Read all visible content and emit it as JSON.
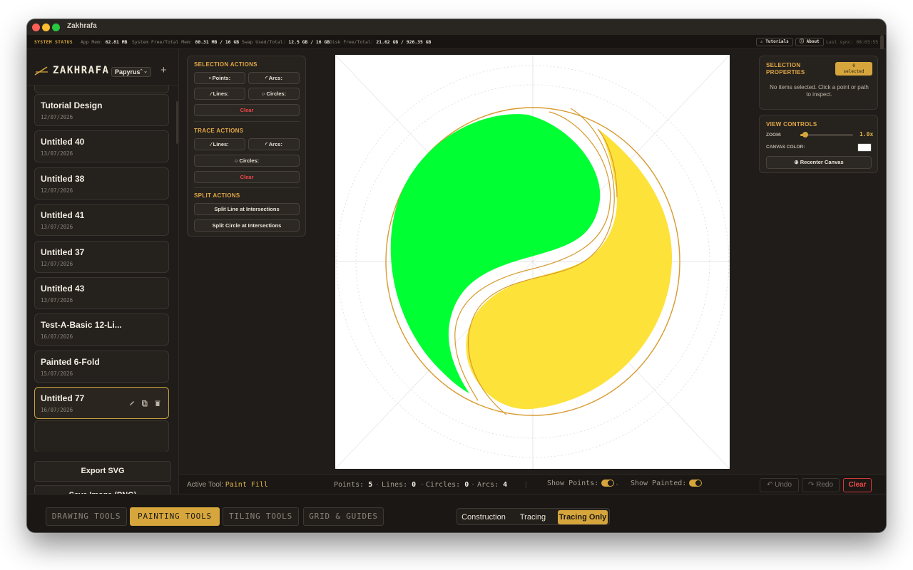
{
  "window": {
    "title": "Zakhrafa"
  },
  "system_status": {
    "label": "SYSTEM STATUS",
    "app_mem_label": "App Mem:",
    "app_mem": "62.81 MB",
    "sys_mem_label": "System Free/Total Mem:",
    "sys_mem": "80.31 MB / 16 GB",
    "swap_label": "Swap Used/Total:",
    "swap": "12.5 GB / 16 GB",
    "disk_label": "Disk Free/Total:",
    "disk": "21.62 GB / 926.35 GB",
    "tutorials_label": "Tutorials",
    "about_label": "About",
    "last_sync": "Last sync: 08:03:55"
  },
  "sidebar": {
    "app_name": "ZAKHRAFA",
    "font_selected": "Papyrus",
    "add_label": "+",
    "designs": [
      {
        "title": "Tutorial Design",
        "date": "12/07/2026"
      },
      {
        "title": "Untitled 40",
        "date": "13/07/2026"
      },
      {
        "title": "Untitled 38",
        "date": "12/07/2026"
      },
      {
        "title": "Untitled 41",
        "date": "13/07/2026"
      },
      {
        "title": "Untitled 37",
        "date": "12/07/2026"
      },
      {
        "title": "Untitled 43",
        "date": "13/07/2026"
      },
      {
        "title": "Test-A-Basic 12-Li...",
        "date": "16/07/2026"
      },
      {
        "title": "Painted 6-Fold",
        "date": "15/07/2026"
      },
      {
        "title": "Untitled 77",
        "date": "16/07/2026",
        "active": true
      }
    ],
    "export_svg_label": "Export SVG",
    "save_png_label": "Save Image (PNG)"
  },
  "actions_panel": {
    "selection_heading": "SELECTION ACTIONS",
    "points_label": "Points:",
    "arcs_label": "Arcs:",
    "lines_label": "Lines:",
    "circles_label": "Circles:",
    "clear_label": "Clear",
    "trace_heading": "TRACE ACTIONS",
    "trace_lines_label": "Lines:",
    "trace_arcs_label": "Arcs:",
    "trace_circles_label": "Circles:",
    "trace_clear_label": "Clear",
    "split_heading": "SPLIT ACTIONS",
    "split_line_label": "Split Line at Intersections",
    "split_circle_label": "Split Circle at Intersections"
  },
  "selection_properties": {
    "heading_line1": "SELECTION",
    "heading_line2": "PROPERTIES",
    "badge_count": "0",
    "badge_label": "selected",
    "empty_text": "No items selected. Click a point or path to inspect."
  },
  "view_controls": {
    "heading": "VIEW CONTROLS",
    "zoom_label": "ZOOM:",
    "zoom_value": "1.0x",
    "zoom_fraction": 0.1,
    "canvas_color_label": "CANVAS COLOR:",
    "canvas_color": "#ffffff",
    "recenter_label": "Recenter Canvas"
  },
  "canvas": {
    "colors": {
      "green": "#00ff33",
      "yellow": "#fde23a",
      "outline": "#d79a2e"
    }
  },
  "bottombar": {
    "active_tool_label": "Active Tool:",
    "active_tool": "Paint Fill",
    "points_label": "Points:",
    "points": "5",
    "lines_label": "Lines:",
    "lines": "0",
    "circles_label": "Circles:",
    "circles": "0",
    "arcs_label": "Arcs:",
    "arcs": "4",
    "show_points_label": "Show Points:",
    "show_painted_label": "Show Painted:",
    "undo_label": "Undo",
    "redo_label": "Redo",
    "clear_label": "Clear"
  },
  "toolbar": {
    "tabs": [
      "DRAWING TOOLS",
      "PAINTING TOOLS",
      "TILING TOOLS",
      "GRID & GUIDES"
    ],
    "active_tab": "PAINTING TOOLS",
    "modes": [
      "Construction",
      "Tracing",
      "Tracing Only"
    ],
    "active_mode": "Tracing Only"
  },
  "theme": {
    "accent": "#d6a63c",
    "danger": "#f04848",
    "background": "#1d1a17"
  }
}
